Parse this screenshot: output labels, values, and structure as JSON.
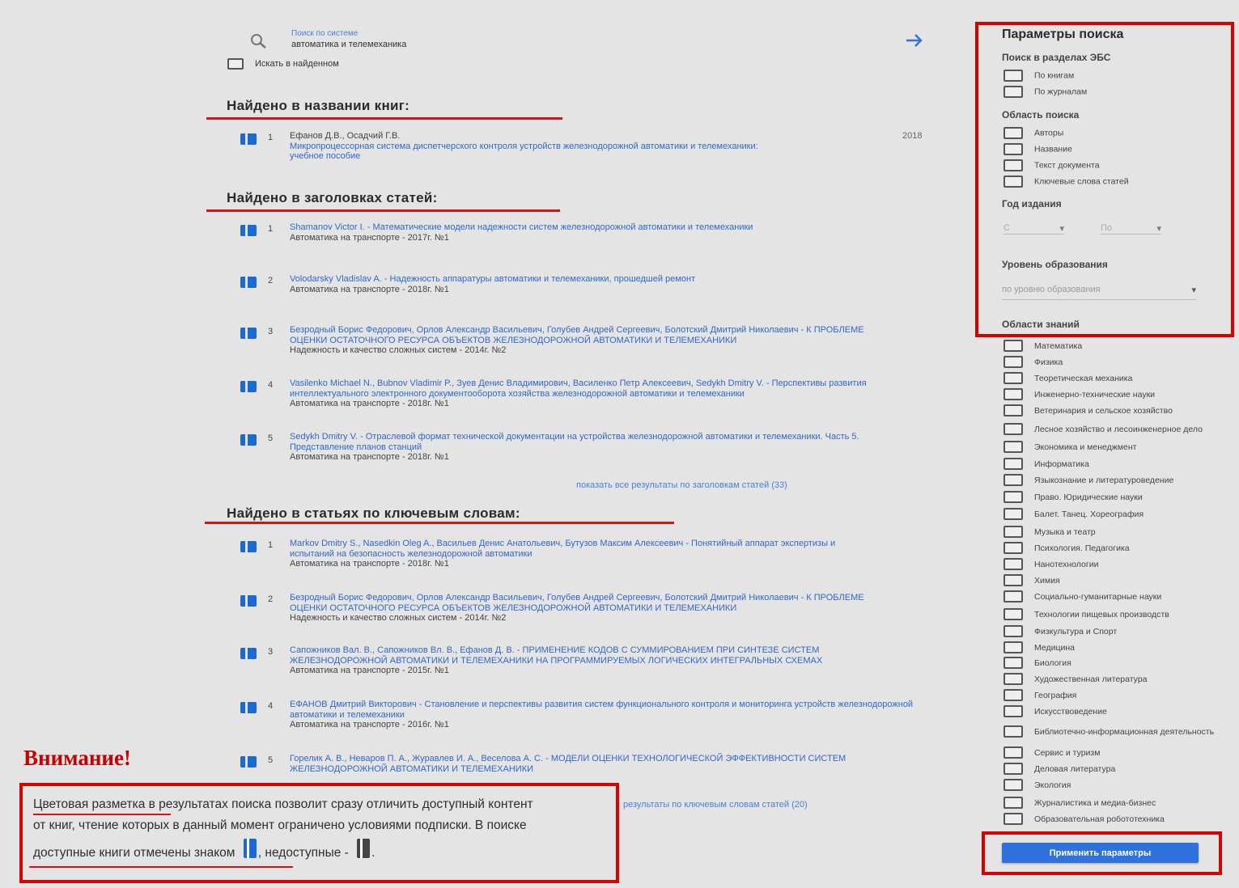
{
  "colors": {
    "accent": "#2f72de",
    "highlight": "#d80000",
    "available": "#1a6ad1",
    "unavailable": "#444444"
  },
  "search": {
    "hint": "Поиск по системе",
    "query": "автоматика и телемеханика",
    "search_within_label": "Искать в найденном"
  },
  "sections": [
    {
      "heading": "Найдено в названии книг:",
      "results": [
        {
          "num": "1",
          "title": "Ефанов Д.В., Осадчий Г.В.",
          "title2": "Микропроцессорная система диспетчерского контроля устройств железнодорожной автоматики и телемеханики: учебное пособие",
          "meta": "",
          "year": "2018"
        }
      ],
      "show_all": ""
    },
    {
      "heading": "Найдено в заголовках статей:",
      "results": [
        {
          "num": "1",
          "title": "Shamanov Victor I. - Математические модели надежности систем железнодорожной автоматики и телемеханики",
          "meta": "Автоматика на транспорте - 2017г. №1"
        },
        {
          "num": "2",
          "title": "Volodarsky Vladislav A. - Надежность аппаратуры автоматики и телемеханики, прошедшей ремонт",
          "meta": "Автоматика на транспорте - 2018г. №1"
        },
        {
          "num": "3",
          "title": "Безродный Борис Федорович, Орлов Александр Васильевич, Голубев Андрей Сергеевич, Болотский Дмитрий Николаевич - К ПРОБЛЕМЕ ОЦЕНКИ ОСТАТОЧНОГО РЕСУРСА ОБЪЕКТОВ ЖЕЛЕЗНОДОРОЖНОЙ АВТОМАТИКИ И ТЕЛЕМЕХАНИКИ",
          "meta": "Надежность и качество сложных систем - 2014г. №2"
        },
        {
          "num": "4",
          "title": "Vasilenko Michael N., Bubnov Vladimir P., Зуев Денис Владимирович, Василенко Петр Алексеевич, Sedykh Dmitry V. - Перспективы развития интеллектуального электронного документооборота хозяйства железнодорожной автоматики и телемеханики",
          "meta": "Автоматика на транспорте - 2018г. №1"
        },
        {
          "num": "5",
          "title": "Sedykh Dmitry V. - Отраслевой формат технической документации на устройства железнодорожной автоматики и телемеханики. Часть 5. Представление планов станций",
          "meta": "Автоматика на транспорте - 2018г. №1"
        }
      ],
      "show_all": "показать все результаты по заголовкам статей (33)"
    },
    {
      "heading": "Найдено в статьях по ключевым словам:",
      "results": [
        {
          "num": "1",
          "title": "Markov Dmitry S., Nasedkin Oleg A., Васильев Денис Анатольевич, Бутузов Максим Алексеевич - Понятийный аппарат экспертизы и испытаний на безопасность железнодорожной автоматики",
          "meta": "Автоматика на транспорте - 2018г. №1"
        },
        {
          "num": "2",
          "title": "Безродный Борис Федорович, Орлов Александр Васильевич, Голубев Андрей Сергеевич, Болотский Дмитрий Николаевич - К ПРОБЛЕМЕ ОЦЕНКИ ОСТАТОЧНОГО РЕСУРСА ОБЪЕКТОВ ЖЕЛЕЗНОДОРОЖНОЙ АВТОМАТИКИ И ТЕЛЕМЕХАНИКИ",
          "meta": "Надежность и качество сложных систем - 2014г. №2"
        },
        {
          "num": "3",
          "title": "Сапожников Вал. В., Сапожников Вл. В., Ефанов Д. В. - ПРИМЕНЕНИЕ КОДОВ С СУММИРОВАНИЕМ ПРИ СИНТЕЗЕ СИСТЕМ ЖЕЛЕЗНОДОРОЖНОЙ АВТОМАТИКИ И ТЕЛЕМЕХАНИКИ НА ПРОГРАММИРУЕМЫХ ЛОГИЧЕСКИХ ИНТЕГРАЛЬНЫХ СХЕМАХ",
          "meta": "Автоматика на транспорте - 2015г. №1"
        },
        {
          "num": "4",
          "title": "ЕФАНОВ Дмитрий Викторович - Становление и перспективы развития систем функционального контроля и мониторинга устройств железнодорожной автоматики и телемеханики",
          "meta": "Автоматика на транспорте - 2016г. №1"
        },
        {
          "num": "5",
          "title": "Горелик А. В., Неваров П. А., Журавлев И. А., Веселова А. С. - МОДЕЛИ ОЦЕНКИ ТЕХНОЛОГИЧЕСКОЙ ЭФФЕКТИВНОСТИ СИСТЕМ ЖЕЛЕЗНОДОРОЖНОЙ АВТОМАТИКИ И ТЕЛЕМЕХАНИКИ",
          "meta": ""
        }
      ],
      "show_all": "результаты по ключевым словам статей (20)"
    }
  ],
  "panel": {
    "title": "Параметры поиска",
    "ebs_label": "Поиск в разделах ЭБС",
    "ebs_options": [
      "По книгам",
      "По журналам"
    ],
    "area_label": "Область поиска",
    "area_options": [
      "Авторы",
      "Название",
      "Текст документа",
      "Ключевые слова статей"
    ],
    "year_label": "Год издания",
    "year_from": "С",
    "year_to": "По",
    "edu_label": "Уровень образования",
    "edu_placeholder": "по уровню образования",
    "knowledge_label": "Области знаний",
    "knowledge_options": [
      "Математика",
      "Физика",
      "Теоретическая механика",
      "Инженерно-технические науки",
      "Ветеринария и сельское хозяйство",
      "Лесное хозяйство и лесоинженерное дело",
      "Экономика и менеджмент",
      "Информатика",
      "Языкознание и литературоведение",
      "Право. Юридические науки",
      "Балет. Танец. Хореография",
      "Музыка и театр",
      "Психология. Педагогика",
      "Нанотехнологии",
      "Химия",
      "Социально-гуманитарные науки",
      "Технологии пищевых производств",
      "Физкультура и Спорт",
      "Медицина",
      "Биология",
      "Художественная литература",
      "География",
      "Искусствоведение",
      "Библиотечно-информационная деятельность",
      "Сервис и туризм",
      "Деловая литература",
      "Экология",
      "Журналистика и медиа-бизнес",
      "Образовательная робототехника"
    ],
    "apply_label": "Применить параметры"
  },
  "notice": {
    "attention": "Внимание!",
    "line1": "Цветовая разметка в результатах поиска позволит сразу отличить доступный контент",
    "line2": "от книг, чтение которых в данный момент ограничено условиями подписки. В поиске",
    "line3_a": "доступные книги отмечены знаком",
    "line3_b": ", недоступные -",
    "line3_c": "."
  }
}
